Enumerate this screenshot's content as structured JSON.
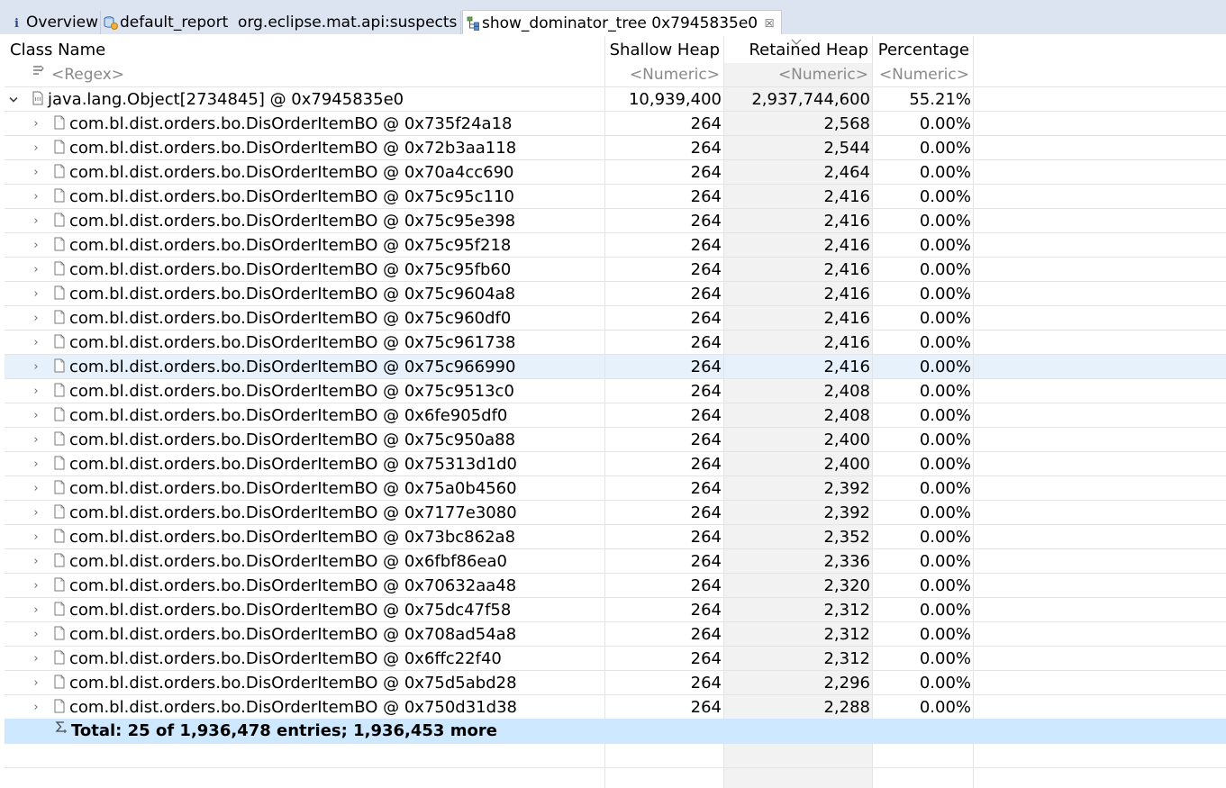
{
  "tabs": [
    {
      "label": "Overview",
      "icon": "info-icon"
    },
    {
      "label": "default_report  org.eclipse.mat.api:suspects",
      "icon": "report-icon"
    },
    {
      "label": "show_dominator_tree 0x7945835e0",
      "icon": "tree-icon",
      "active": true,
      "close": "☒"
    }
  ],
  "columns": {
    "class_name": "Class Name",
    "shallow_heap": "Shallow Heap",
    "retained_heap": "Retained Heap",
    "percentage": "Percentage"
  },
  "filters": {
    "class_name": "<Regex>",
    "shallow_heap": "<Numeric>",
    "retained_heap": "<Numeric>",
    "percentage": "<Numeric>"
  },
  "root": {
    "name": "java.lang.Object[2734845] @ 0x7945835e0",
    "shallow": "10,939,400",
    "retained": "2,937,744,600",
    "percentage": "55.21%",
    "expander": "⌄"
  },
  "children": [
    {
      "name": "com.bl.dist.orders.bo.DisOrderItemBO @ 0x735f24a18",
      "shallow": "264",
      "retained": "2,568",
      "percentage": "0.00%"
    },
    {
      "name": "com.bl.dist.orders.bo.DisOrderItemBO @ 0x72b3aa118",
      "shallow": "264",
      "retained": "2,544",
      "percentage": "0.00%"
    },
    {
      "name": "com.bl.dist.orders.bo.DisOrderItemBO @ 0x70a4cc690",
      "shallow": "264",
      "retained": "2,464",
      "percentage": "0.00%"
    },
    {
      "name": "com.bl.dist.orders.bo.DisOrderItemBO @ 0x75c95c110",
      "shallow": "264",
      "retained": "2,416",
      "percentage": "0.00%"
    },
    {
      "name": "com.bl.dist.orders.bo.DisOrderItemBO @ 0x75c95e398",
      "shallow": "264",
      "retained": "2,416",
      "percentage": "0.00%"
    },
    {
      "name": "com.bl.dist.orders.bo.DisOrderItemBO @ 0x75c95f218",
      "shallow": "264",
      "retained": "2,416",
      "percentage": "0.00%"
    },
    {
      "name": "com.bl.dist.orders.bo.DisOrderItemBO @ 0x75c95fb60",
      "shallow": "264",
      "retained": "2,416",
      "percentage": "0.00%"
    },
    {
      "name": "com.bl.dist.orders.bo.DisOrderItemBO @ 0x75c9604a8",
      "shallow": "264",
      "retained": "2,416",
      "percentage": "0.00%"
    },
    {
      "name": "com.bl.dist.orders.bo.DisOrderItemBO @ 0x75c960df0",
      "shallow": "264",
      "retained": "2,416",
      "percentage": "0.00%"
    },
    {
      "name": "com.bl.dist.orders.bo.DisOrderItemBO @ 0x75c961738",
      "shallow": "264",
      "retained": "2,416",
      "percentage": "0.00%"
    },
    {
      "name": "com.bl.dist.orders.bo.DisOrderItemBO @ 0x75c966990",
      "shallow": "264",
      "retained": "2,416",
      "percentage": "0.00%",
      "selected": true
    },
    {
      "name": "com.bl.dist.orders.bo.DisOrderItemBO @ 0x75c9513c0",
      "shallow": "264",
      "retained": "2,408",
      "percentage": "0.00%"
    },
    {
      "name": "com.bl.dist.orders.bo.DisOrderItemBO @ 0x6fe905df0",
      "shallow": "264",
      "retained": "2,408",
      "percentage": "0.00%"
    },
    {
      "name": "com.bl.dist.orders.bo.DisOrderItemBO @ 0x75c950a88",
      "shallow": "264",
      "retained": "2,400",
      "percentage": "0.00%"
    },
    {
      "name": "com.bl.dist.orders.bo.DisOrderItemBO @ 0x75313d1d0",
      "shallow": "264",
      "retained": "2,400",
      "percentage": "0.00%"
    },
    {
      "name": "com.bl.dist.orders.bo.DisOrderItemBO @ 0x75a0b4560",
      "shallow": "264",
      "retained": "2,392",
      "percentage": "0.00%"
    },
    {
      "name": "com.bl.dist.orders.bo.DisOrderItemBO @ 0x7177e3080",
      "shallow": "264",
      "retained": "2,392",
      "percentage": "0.00%"
    },
    {
      "name": "com.bl.dist.orders.bo.DisOrderItemBO @ 0x73bc862a8",
      "shallow": "264",
      "retained": "2,352",
      "percentage": "0.00%"
    },
    {
      "name": "com.bl.dist.orders.bo.DisOrderItemBO @ 0x6fbf86ea0",
      "shallow": "264",
      "retained": "2,336",
      "percentage": "0.00%"
    },
    {
      "name": "com.bl.dist.orders.bo.DisOrderItemBO @ 0x70632aa48",
      "shallow": "264",
      "retained": "2,320",
      "percentage": "0.00%"
    },
    {
      "name": "com.bl.dist.orders.bo.DisOrderItemBO @ 0x75dc47f58",
      "shallow": "264",
      "retained": "2,312",
      "percentage": "0.00%"
    },
    {
      "name": "com.bl.dist.orders.bo.DisOrderItemBO @ 0x708ad54a8",
      "shallow": "264",
      "retained": "2,312",
      "percentage": "0.00%"
    },
    {
      "name": "com.bl.dist.orders.bo.DisOrderItemBO @ 0x6ffc22f40",
      "shallow": "264",
      "retained": "2,312",
      "percentage": "0.00%"
    },
    {
      "name": "com.bl.dist.orders.bo.DisOrderItemBO @ 0x75d5abd28",
      "shallow": "264",
      "retained": "2,296",
      "percentage": "0.00%"
    },
    {
      "name": "com.bl.dist.orders.bo.DisOrderItemBO @ 0x750d31d38",
      "shallow": "264",
      "retained": "2,288",
      "percentage": "0.00%"
    }
  ],
  "child_expander": "›",
  "total": {
    "label": "Total: 25 of 1,936,478 entries; 1,936,453 more",
    "icon": "sigma-icon"
  },
  "colors": {
    "tabbar": "#dbe4f0",
    "selected_row": "#e6f1fc",
    "total_row": "#cde8ff",
    "grid": "#e4e4e4"
  }
}
